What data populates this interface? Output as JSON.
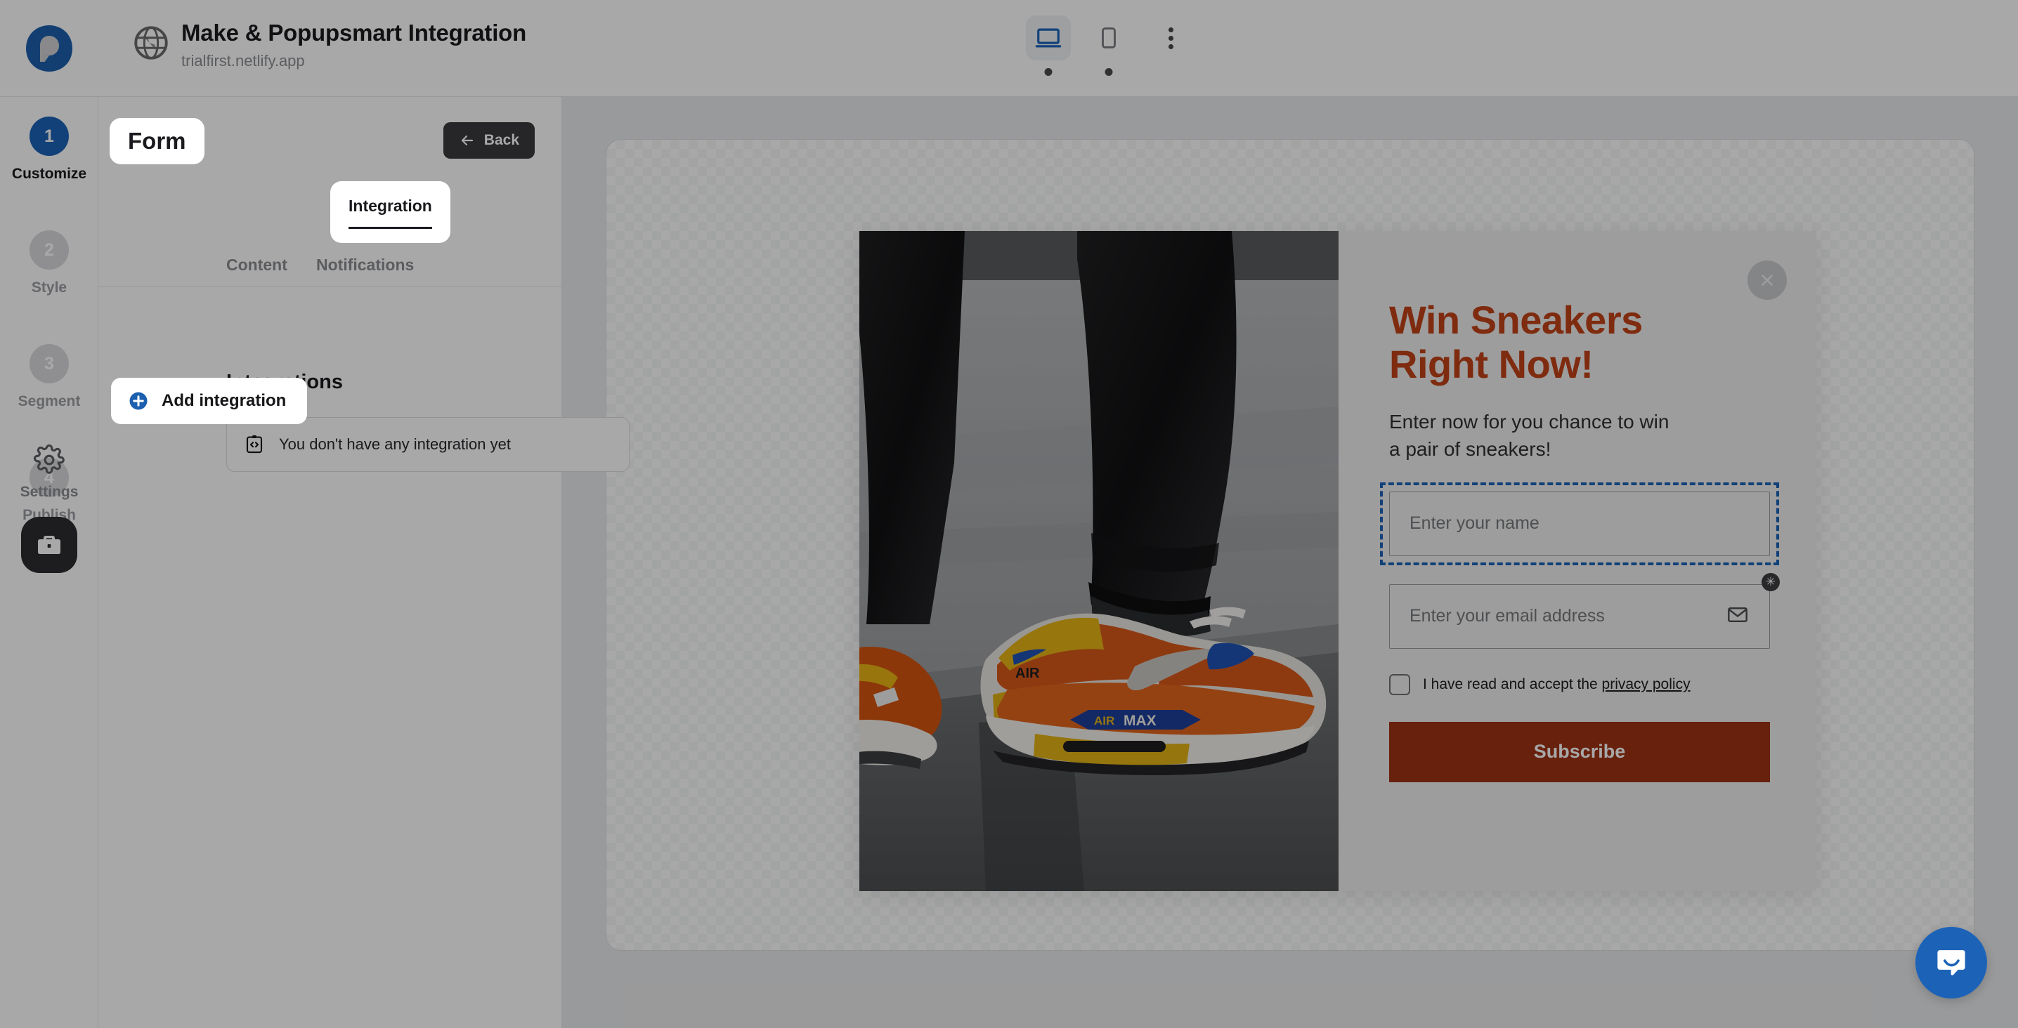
{
  "header": {
    "logo_icon": "popupsmart-logo-icon",
    "favicon_icon": "globe-icon",
    "title": "Make & Popupsmart Integration",
    "url": "trialfirst.netlify.app",
    "devices": [
      {
        "id": "desktop",
        "icon": "desktop-icon",
        "active": true
      },
      {
        "id": "mobile",
        "icon": "mobile-icon",
        "active": false
      }
    ],
    "more_icon": "more-vertical-icon"
  },
  "sidebar": {
    "steps": [
      {
        "number": "1",
        "label": "Customize",
        "active": true
      },
      {
        "number": "2",
        "label": "Style",
        "active": false
      },
      {
        "number": "3",
        "label": "Segment",
        "active": false
      },
      {
        "number": "4",
        "label": "Publish",
        "active": false
      }
    ],
    "settings": {
      "label": "Settings",
      "icon": "gear-icon"
    },
    "workspace": {
      "icon": "briefcase-icon"
    }
  },
  "panel": {
    "title": "Form",
    "back_label": "Back",
    "back_icon": "arrow-left-icon",
    "tabs": [
      {
        "label": "Content",
        "active": false
      },
      {
        "label": "Notifications",
        "active": false
      },
      {
        "label": "Integration",
        "active": true
      }
    ],
    "integrations_heading": "Integrations",
    "empty_state": {
      "icon": "code-clipboard-icon",
      "text": "You don't have any integration yet"
    },
    "add_integration": {
      "icon": "plus-circle-icon",
      "label": "Add integration"
    }
  },
  "popup": {
    "close_icon": "close-icon",
    "image_alt": "orange-yellow-nike-air-max-sneakers-photo",
    "headline": "Win Sneakers\nRight Now!",
    "subtext": "Enter now for you chance to win\na pair of sneakers!",
    "fields": [
      {
        "name": "name-field",
        "placeholder": "Enter your name",
        "value": "",
        "selected": true,
        "icon": null
      },
      {
        "name": "email-field",
        "placeholder": "Enter your email address",
        "value": "",
        "selected": false,
        "icon": "envelope-icon",
        "badge_icon": "asterisk-badge-icon"
      }
    ],
    "consent": {
      "text": "I have read and accept the",
      "link_text": "privacy policy",
      "checked": false
    },
    "submit_label": "Subscribe"
  },
  "chat": {
    "icon": "intercom-chat-icon"
  },
  "colors": {
    "brand_blue": "#1c63b8",
    "popup_headline": "#c14217",
    "popup_button": "#9e3314",
    "step_inactive": "#d9dadd",
    "dark_button": "#3b3b3f"
  }
}
